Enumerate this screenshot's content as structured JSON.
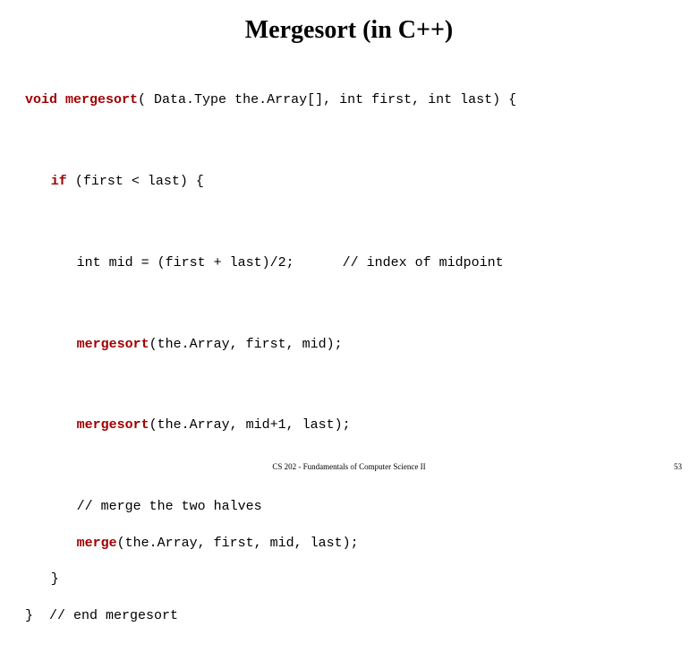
{
  "title": "Mergesort (in C++)",
  "code": {
    "l1_kw": "void",
    "l1_fn": "mergesort",
    "l1_rest": "( Data.Type the.Array[], int first, int last) {",
    "l2_kw": "if",
    "l2_rest": " (first < last) {",
    "l3": "int mid = (first + last)/2;      // index of midpoint",
    "l4_fn": "mergesort",
    "l4_rest": "(the.Array, first, mid);",
    "l5_fn": "mergesort",
    "l5_rest": "(the.Array, mid+1, last);",
    "l6": "// merge the two halves",
    "l7_fn": "merge",
    "l7_rest": "(the.Array, first, mid, last);",
    "l8": "}",
    "l9": "}  // end mergesort"
  },
  "footer": "CS 202 - Fundamentals of Computer Science II",
  "pagenum": "53"
}
